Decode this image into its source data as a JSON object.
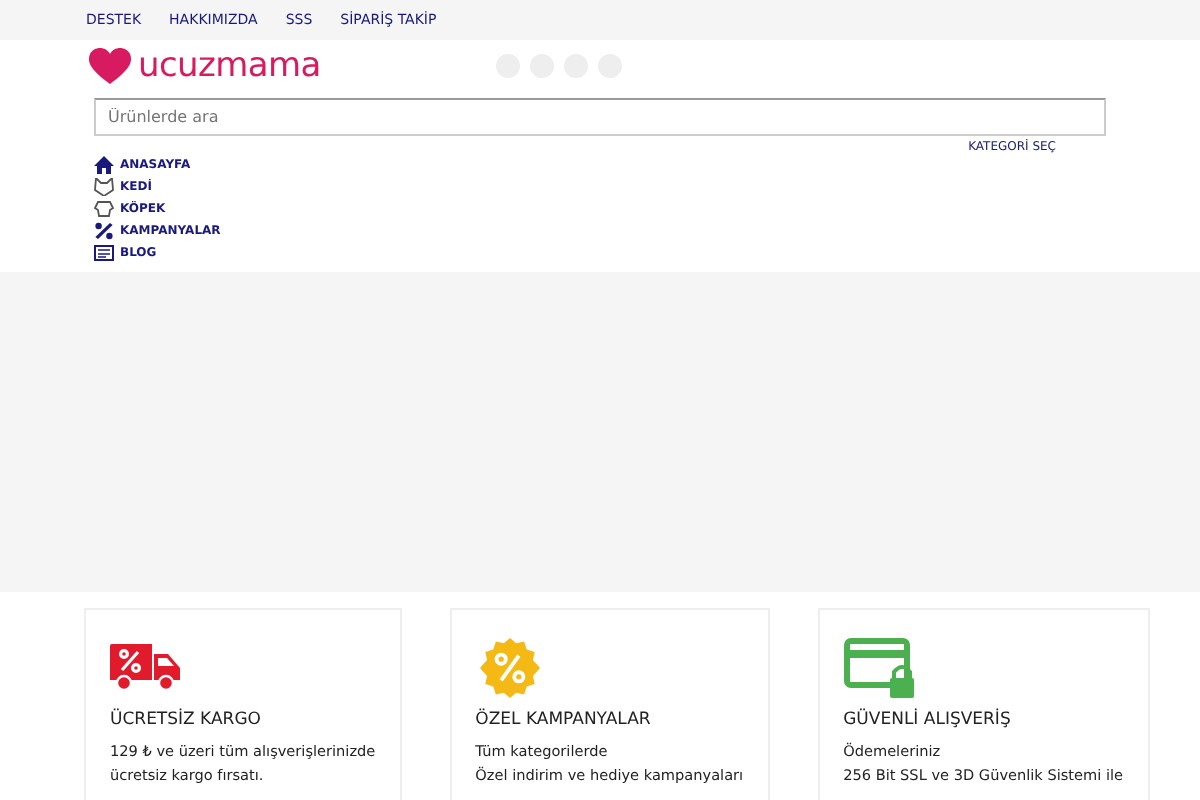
{
  "top_links": [
    "DESTEK",
    "HAKKIMIZDA",
    "SSS",
    "SİPARİŞ TAKİP"
  ],
  "logo": {
    "text": "ucuzmama"
  },
  "search": {
    "placeholder": "Ürünlerde ara"
  },
  "category_select": "KATEGORİ SEÇ",
  "nav": [
    {
      "label": "ANASAYFA",
      "kind": "home"
    },
    {
      "label": "KEDİ",
      "kind": "cat"
    },
    {
      "label": "KÖPEK",
      "kind": "dog"
    },
    {
      "label": "KAMPANYALAR",
      "kind": "percent"
    },
    {
      "label": "BLOG",
      "kind": "blog"
    }
  ],
  "features": [
    {
      "kind": "truck",
      "title": "ÜCRETSİZ KARGO",
      "lines": [
        "129 ₺ ve üzeri tüm alışverişlerinizde",
        "ücretsiz kargo fırsatı."
      ]
    },
    {
      "kind": "badge",
      "title": "ÖZEL KAMPANYALAR",
      "lines": [
        "Tüm kategorilerde",
        "Özel indirim ve hediye kampanyaları"
      ]
    },
    {
      "kind": "card",
      "title": "GÜVENLİ ALIŞVERİŞ",
      "lines": [
        "Ödemeleriniz",
        "256 Bit SSL ve 3D Güvenlik Sistemi ile"
      ]
    }
  ]
}
